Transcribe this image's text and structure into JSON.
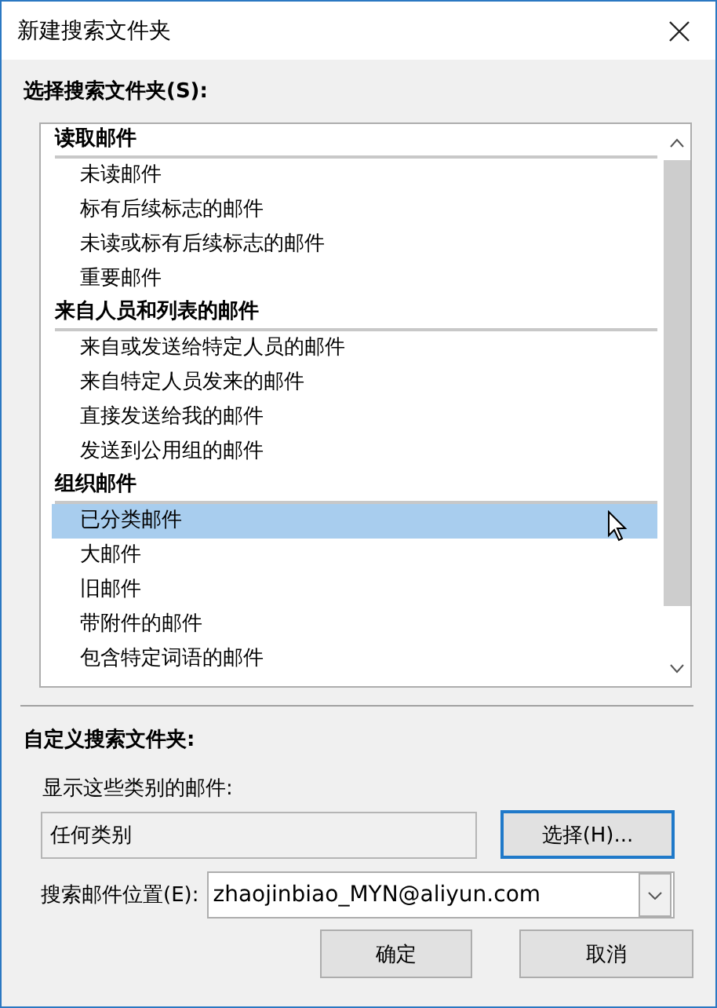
{
  "window": {
    "title": "新建搜索文件夹"
  },
  "folder_list": {
    "label": "选择搜索文件夹(S):",
    "groups": [
      {
        "title": "读取邮件",
        "items": [
          {
            "label": "未读邮件",
            "selected": false
          },
          {
            "label": "标有后续标志的邮件",
            "selected": false
          },
          {
            "label": "未读或标有后续标志的邮件",
            "selected": false
          },
          {
            "label": "重要邮件",
            "selected": false
          }
        ]
      },
      {
        "title": "来自人员和列表的邮件",
        "items": [
          {
            "label": "来自或发送给特定人员的邮件",
            "selected": false
          },
          {
            "label": "来自特定人员发来的邮件",
            "selected": false
          },
          {
            "label": "直接发送给我的邮件",
            "selected": false
          },
          {
            "label": "发送到公用组的邮件",
            "selected": false
          }
        ]
      },
      {
        "title": "组织邮件",
        "items": [
          {
            "label": "已分类邮件",
            "selected": true
          },
          {
            "label": "大邮件",
            "selected": false
          },
          {
            "label": "旧邮件",
            "selected": false
          },
          {
            "label": "带附件的邮件",
            "selected": false
          },
          {
            "label": "包含特定词语的邮件",
            "selected": false
          }
        ]
      }
    ]
  },
  "custom": {
    "title": "自定义搜索文件夹:",
    "categories_label": "显示这些类别的邮件:",
    "categories_value": "任何类别",
    "choose_button": "选择(H)...",
    "location_label": "搜索邮件位置(E):",
    "location_value": "zhaojinbiao_MYN@aliyun.com"
  },
  "buttons": [
    "确定",
    "取消"
  ]
}
